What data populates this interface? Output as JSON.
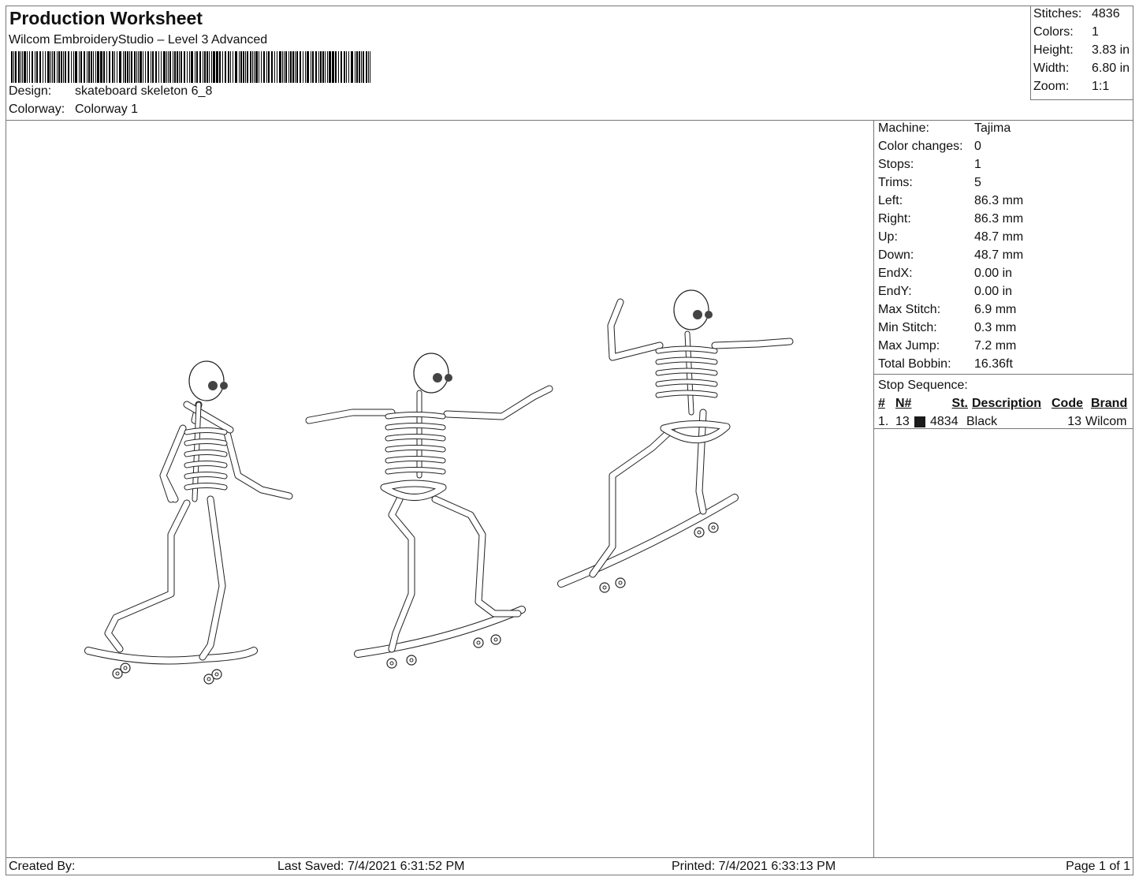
{
  "header": {
    "title": "Production Worksheet",
    "software": "Wilcom EmbroideryStudio – Level 3 Advanced",
    "design_label": "Design:",
    "design": "skateboard skeleton 6_8",
    "colorway_label": "Colorway:",
    "colorway": "Colorway 1"
  },
  "summary": [
    {
      "label": "Stitches:",
      "value": "4836"
    },
    {
      "label": "Colors:",
      "value": "1"
    },
    {
      "label": "Height:",
      "value": "3.83 in"
    },
    {
      "label": "Width:",
      "value": "6.80 in"
    },
    {
      "label": "Zoom:",
      "value": "1:1"
    }
  ],
  "info": [
    {
      "label": "Machine:",
      "value": "Tajima"
    },
    {
      "label": "Color changes:",
      "value": "0"
    },
    {
      "label": "Stops:",
      "value": "1"
    },
    {
      "label": "Trims:",
      "value": "5"
    },
    {
      "label": "Left:",
      "value": "86.3 mm"
    },
    {
      "label": "Right:",
      "value": "86.3 mm"
    },
    {
      "label": "Up:",
      "value": "48.7 mm"
    },
    {
      "label": "Down:",
      "value": "48.7 mm"
    },
    {
      "label": "EndX:",
      "value": "0.00 in"
    },
    {
      "label": "EndY:",
      "value": "0.00 in"
    },
    {
      "label": "Max Stitch:",
      "value": "6.9 mm"
    },
    {
      "label": "Min Stitch:",
      "value": "0.3 mm"
    },
    {
      "label": "Max Jump:",
      "value": "7.2 mm"
    },
    {
      "label": "Total Bobbin:",
      "value": "16.36ft"
    }
  ],
  "stop_sequence": {
    "title": "Stop Sequence:",
    "headers": [
      "#",
      "N#",
      "St.",
      "Description",
      "Code",
      "Brand"
    ],
    "rows": [
      {
        "num": "1.",
        "n": "13",
        "color": "#1a1a1a",
        "st": "4834",
        "description": "Black",
        "code": "13",
        "brand": "Wilcom"
      }
    ]
  },
  "footer": {
    "created": "Created By:",
    "saved": "Last Saved: 7/4/2021 6:31:52 PM",
    "printed": "Printed: 7/4/2021 6:33:13 PM",
    "page": "Page 1 of 1"
  }
}
